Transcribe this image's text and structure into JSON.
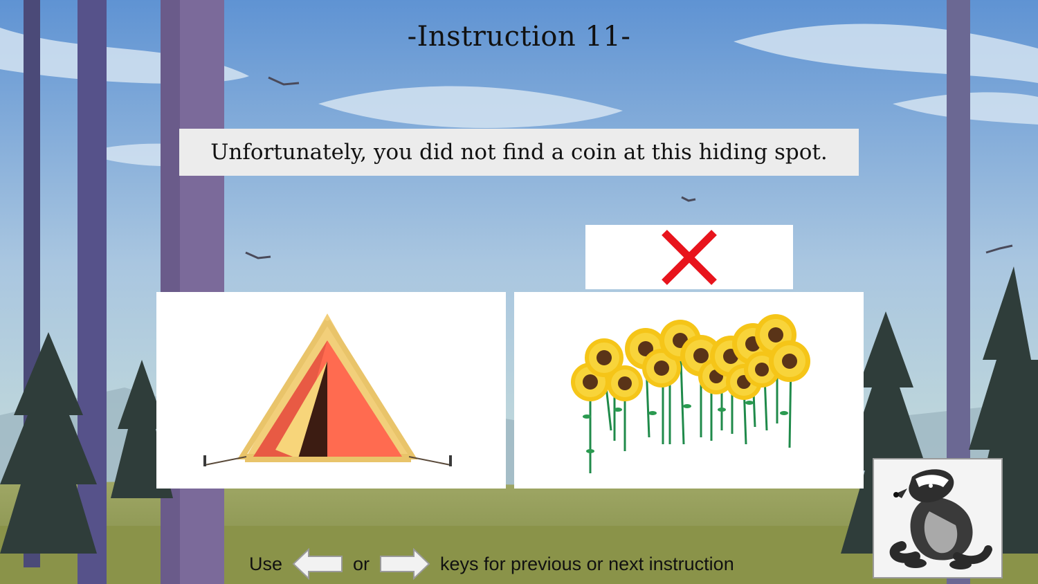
{
  "title": "-Instruction 11-",
  "message": "Unfortunately, you did not find a coin at this hiding spot.",
  "result_icon": "red-x-icon",
  "colors": {
    "cross": "#e8141c",
    "message_bg": "#ececec",
    "sky_top": "#5f93d3",
    "ground": "#8e9a4e"
  },
  "cards": [
    {
      "name": "tent",
      "icon": "tent-image"
    },
    {
      "name": "sunflowers",
      "icon": "sunflowers-image"
    }
  ],
  "avatar": {
    "icon": "badger-image"
  },
  "footer": {
    "use": "Use",
    "or": "or",
    "rest": "keys for previous or next instruction",
    "left_key_icon": "left-arrow-key-icon",
    "right_key_icon": "right-arrow-key-icon"
  }
}
